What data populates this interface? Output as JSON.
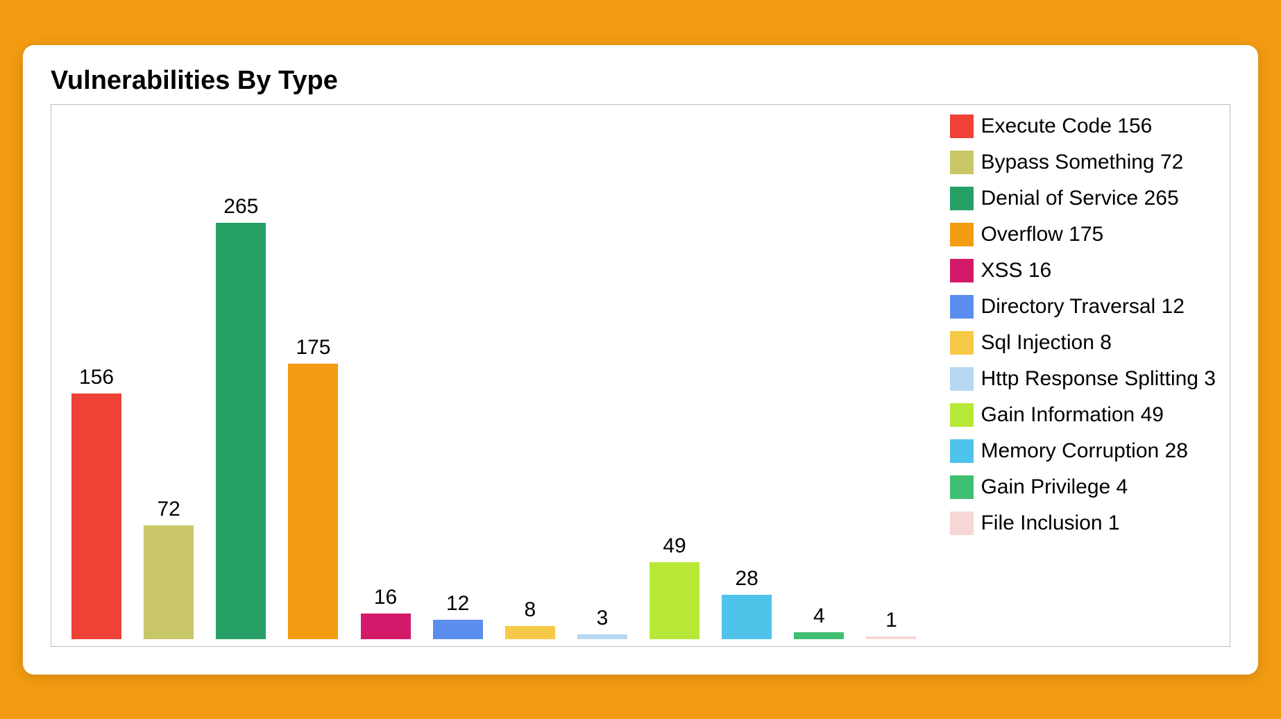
{
  "title": "Vulnerabilities By Type",
  "chart_data": {
    "type": "bar",
    "title": "Vulnerabilities By Type",
    "xlabel": "",
    "ylabel": "",
    "ylim": [
      0,
      265
    ],
    "categories": [
      "Execute Code",
      "Bypass Something",
      "Denial of Service",
      "Overflow",
      "XSS",
      "Directory Traversal",
      "Sql Injection",
      "Http Response Splitting",
      "Gain Information",
      "Memory Corruption",
      "Gain Privilege",
      "File Inclusion"
    ],
    "values": [
      156,
      72,
      265,
      175,
      16,
      12,
      8,
      3,
      49,
      28,
      4,
      1
    ],
    "colors": [
      "#ef4136",
      "#c9c667",
      "#27a066",
      "#f39c12",
      "#d31a6a",
      "#5b8def",
      "#f7c948",
      "#b7d8f0",
      "#b8e837",
      "#4fc3ea",
      "#3fbf71",
      "#f7d6d6"
    ],
    "legend_labels": [
      "Execute Code 156",
      "Bypass Something 72",
      "Denial of Service 265",
      "Overflow 175",
      "XSS 16",
      "Directory Traversal 12",
      "Sql Injection 8",
      "Http Response Splitting 3",
      "Gain Information 49",
      "Memory Corruption 28",
      "Gain Privilege 4",
      "File Inclusion 1"
    ]
  }
}
